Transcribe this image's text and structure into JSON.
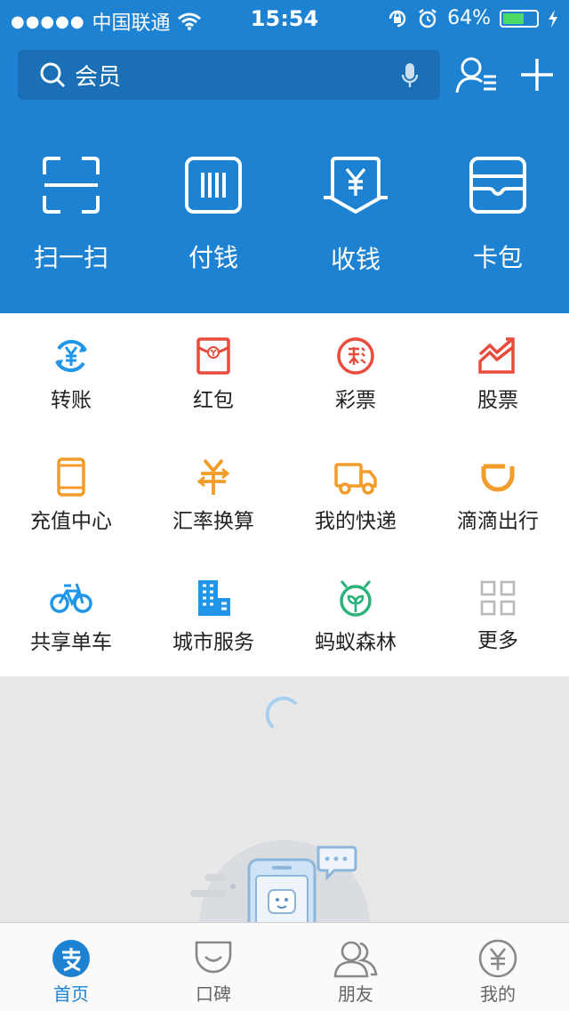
{
  "status_bar": {
    "signal": "●●●●●",
    "carrier": "中国联通",
    "time": "15:54",
    "battery": "64%",
    "battery_level": 0.64
  },
  "search": {
    "placeholder": "会员"
  },
  "quick_actions": [
    {
      "label": "扫一扫",
      "icon": "scan-icon"
    },
    {
      "label": "付钱",
      "icon": "barcode-icon"
    },
    {
      "label": "收钱",
      "icon": "yuan-receive-icon"
    },
    {
      "label": "卡包",
      "icon": "wallet-icon"
    }
  ],
  "services": [
    {
      "label": "转账",
      "icon": "transfer-icon",
      "color": "#2196e8"
    },
    {
      "label": "红包",
      "icon": "red-envelope-icon",
      "color": "#e94b3c"
    },
    {
      "label": "彩票",
      "icon": "lottery-icon",
      "color": "#e94b3c"
    },
    {
      "label": "股票",
      "icon": "stock-icon",
      "color": "#e94b3c"
    },
    {
      "label": "充值中心",
      "icon": "phone-topup-icon",
      "color": "#f39c2a"
    },
    {
      "label": "汇率换算",
      "icon": "exchange-icon",
      "color": "#f39c2a"
    },
    {
      "label": "我的快递",
      "icon": "delivery-truck-icon",
      "color": "#f39c2a"
    },
    {
      "label": "滴滴出行",
      "icon": "didi-icon",
      "color": "#f39c2a"
    },
    {
      "label": "共享单车",
      "icon": "bicycle-icon",
      "color": "#2196e8"
    },
    {
      "label": "城市服务",
      "icon": "city-building-icon",
      "color": "#2196e8"
    },
    {
      "label": "蚂蚁森林",
      "icon": "ant-forest-icon",
      "color": "#2ab27b"
    },
    {
      "label": "更多",
      "icon": "more-grid-icon",
      "color": "#b8b8b8"
    }
  ],
  "tabs": [
    {
      "label": "首页",
      "icon": "alipay-home-icon",
      "active": true
    },
    {
      "label": "口碑",
      "icon": "koubei-icon",
      "active": false
    },
    {
      "label": "朋友",
      "icon": "friends-icon",
      "active": false
    },
    {
      "label": "我的",
      "icon": "my-yuan-icon",
      "active": false
    }
  ],
  "colors": {
    "brand_blue": "#1e82d2",
    "tab_active": "#1e82d2",
    "tab_inactive": "#666666"
  }
}
